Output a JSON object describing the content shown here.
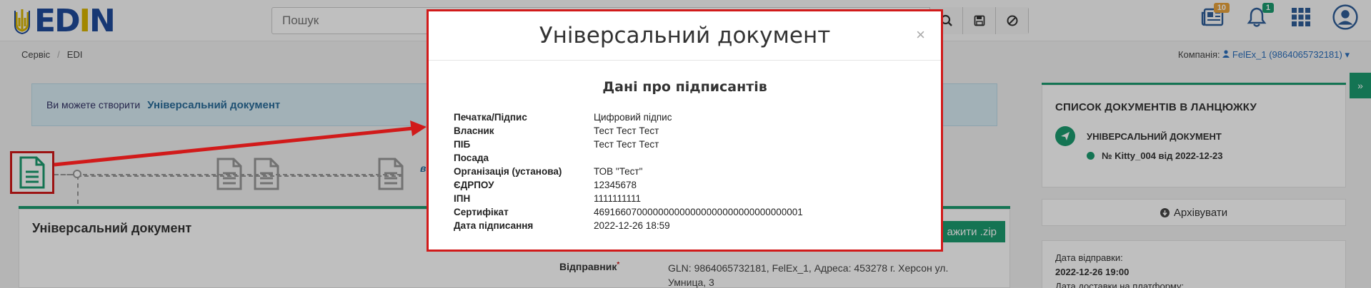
{
  "topbar": {
    "logo_text": "EDIN",
    "search_placeholder": "Пошук",
    "notifications": {
      "news_count": "10",
      "bell_count": "1"
    }
  },
  "breadcrumb": {
    "items": [
      "Сервіс",
      "EDI"
    ]
  },
  "company": {
    "label": "Компанія:",
    "value": "FelEx_1 (9864065732181)"
  },
  "notice": {
    "text": "Ви можете створити",
    "link": "Універсальний документ"
  },
  "chain": {
    "label_fragment": "в"
  },
  "document_card": {
    "title": "Універсальний документ",
    "zip_button": "ажити .zip",
    "sender_label": "Відправник",
    "sender_value": "GLN: 9864065732181, FelEx_1, Адреса: 453278 г. Херсон ул. Умница, 3"
  },
  "right_panel": {
    "title": "СПИСОК ДОКУМЕНТІВ В ЛАНЦЮЖКУ",
    "doc_type": "УНІВЕРСАЛЬНИЙ ДОКУМЕНТ",
    "doc_ref": "№ Kitty_004 від 2022-12-23",
    "archive_button": "Архівувати",
    "send_date_label": "Дата відправки:",
    "send_date_value": "2022-12-26 19:00",
    "delivery_label": "Дата доставки на платформу:"
  },
  "modal": {
    "title": "Універсальний документ",
    "close": "×",
    "subtitle": "Дані про підписантів",
    "rows": [
      {
        "label": "Печатка/Підпис",
        "value": "Цифровий підпис"
      },
      {
        "label": "Власник",
        "value": "Тест Тест Тест"
      },
      {
        "label": "ПІБ",
        "value": "Тест Тест Тест"
      },
      {
        "label": "Посада",
        "value": ""
      },
      {
        "label": "Організація (установа)",
        "value": "ТОВ \"Тест\""
      },
      {
        "label": "ЄДРПОУ",
        "value": "12345678"
      },
      {
        "label": "ІПН",
        "value": "1111111111"
      },
      {
        "label": "Сертифікат",
        "value": "469166070000000000000000000000000000001"
      },
      {
        "label": "Дата підписання",
        "value": "2022-12-26 18:59"
      }
    ]
  },
  "colors": {
    "accent_green": "#1b9b6f",
    "annotation_red": "#d11a1a",
    "brand_blue": "#1f4b9b",
    "brand_yellow": "#d9b400"
  }
}
